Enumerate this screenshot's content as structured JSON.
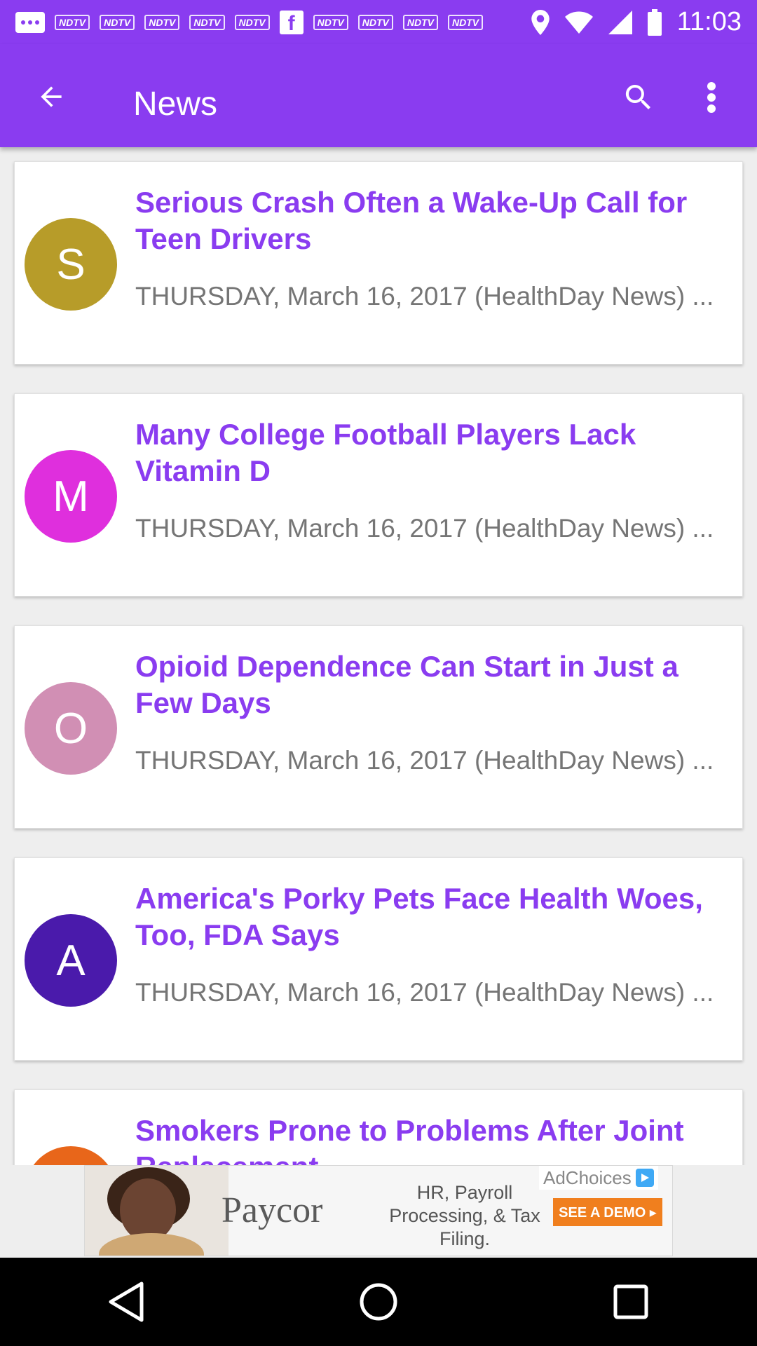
{
  "status_bar": {
    "time": "11:03",
    "notification_icons": [
      "NDTV",
      "NDTV",
      "NDTV",
      "NDTV",
      "NDTV",
      "f",
      "NDTV",
      "NDTV",
      "NDTV",
      "NDTV"
    ]
  },
  "app_bar": {
    "title": "News",
    "back_icon": "arrow-back-icon",
    "search_icon": "search-icon",
    "more_icon": "more-vert-icon"
  },
  "colors": {
    "primary": "#8a3cf0",
    "title_text": "#8a3cf0",
    "subtitle_text": "#757575"
  },
  "articles": [
    {
      "letter": "S",
      "avatar_color": "#b79c29",
      "title": "Serious Crash Often a Wake-Up Call for Teen Drivers",
      "subtitle": "THURSDAY, March 16, 2017 (HealthDay News) ..."
    },
    {
      "letter": "M",
      "avatar_color": "#df2fdd",
      "title": "Many College Football Players Lack Vitamin D",
      "subtitle": "THURSDAY, March 16, 2017 (HealthDay News) ..."
    },
    {
      "letter": "O",
      "avatar_color": "#d18fb4",
      "title": "Opioid Dependence Can Start in Just a Few Days",
      "subtitle": "THURSDAY, March 16, 2017 (HealthDay News) ..."
    },
    {
      "letter": "A",
      "avatar_color": "#4a1aab",
      "title": "America's Porky Pets Face Health Woes, Too, FDA Says",
      "subtitle": "THURSDAY, March 16, 2017 (HealthDay News) ..."
    },
    {
      "letter": "",
      "avatar_color": "#e8661a",
      "title": "Smokers Prone to Problems After Joint Replacement",
      "subtitle": ""
    }
  ],
  "ad": {
    "brand": "Paycor",
    "copy": "HR, Payroll Processing, & Tax Filing.",
    "cta": "SEE A DEMO ▸",
    "adchoices": "AdChoices"
  },
  "nav_bar": {
    "back_icon": "nav-back-icon",
    "home_icon": "nav-home-icon",
    "recents_icon": "nav-recents-icon"
  }
}
